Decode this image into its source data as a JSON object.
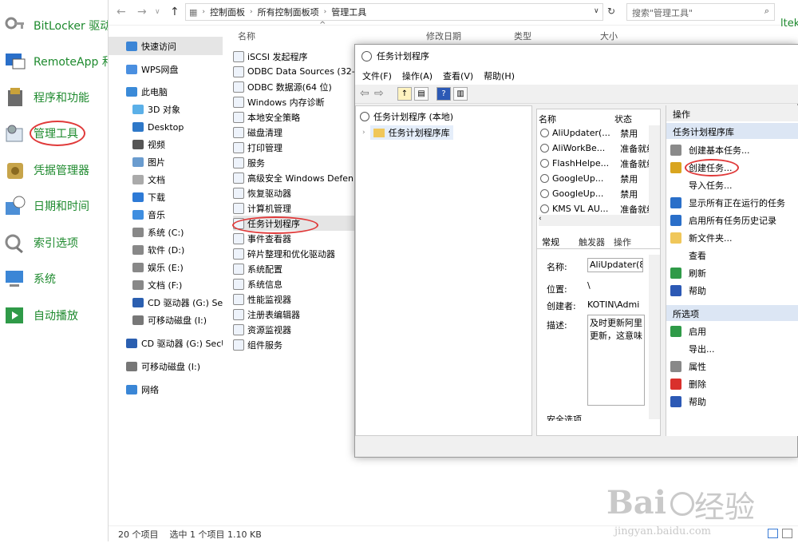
{
  "control_panel": {
    "items": [
      {
        "label": "BitLocker 驱动器加密",
        "icon": "bitlocker-key-icon"
      },
      {
        "label": "RemoteApp 和桌面连接",
        "icon": "remoteapp-icon"
      },
      {
        "label": "程序和功能",
        "icon": "programs-icon"
      },
      {
        "label": "管理工具",
        "icon": "admin-tools-icon"
      },
      {
        "label": "凭据管理器",
        "icon": "credential-vault-icon"
      },
      {
        "label": "日期和时间",
        "icon": "calendar-clock-icon"
      },
      {
        "label": "索引选项",
        "icon": "indexing-icon"
      },
      {
        "label": "系统",
        "icon": "system-computer-icon"
      },
      {
        "label": "自动播放",
        "icon": "autoplay-icon"
      }
    ]
  },
  "explorer": {
    "breadcrumb": [
      "控制面板",
      "所有控制面板项",
      "管理工具"
    ],
    "search_placeholder": "搜索\"管理工具\"",
    "right_edge_text": "ltek",
    "sidebar": [
      {
        "label": "快速访问",
        "icon": "star-icon"
      },
      {
        "label": "WPS网盘",
        "icon": "cloud-icon"
      },
      {
        "label": "此电脑",
        "icon": "computer-icon"
      },
      {
        "label": "3D 对象",
        "icon": "cube-icon"
      },
      {
        "label": "Desktop",
        "icon": "desktop-icon"
      },
      {
        "label": "视频",
        "icon": "video-icon"
      },
      {
        "label": "图片",
        "icon": "picture-icon"
      },
      {
        "label": "文档",
        "icon": "document-icon"
      },
      {
        "label": "下载",
        "icon": "download-icon"
      },
      {
        "label": "音乐",
        "icon": "music-icon"
      },
      {
        "label": "系统 (C:)",
        "icon": "drive-icon"
      },
      {
        "label": "软件 (D:)",
        "icon": "drive-icon"
      },
      {
        "label": "娱乐 (E:)",
        "icon": "drive-icon"
      },
      {
        "label": "文档 (F:)",
        "icon": "drive-icon"
      },
      {
        "label": "CD 驱动器 (G:) SecU",
        "icon": "cd-drive-icon"
      },
      {
        "label": "可移动磁盘 (I:)",
        "icon": "removable-drive-icon"
      },
      {
        "label": "CD 驱动器 (G:) SecU",
        "icon": "cd-drive-icon"
      },
      {
        "label": "可移动磁盘 (I:)",
        "icon": "removable-drive-icon"
      },
      {
        "label": "网络",
        "icon": "network-icon"
      }
    ],
    "columns": [
      "名称",
      "修改日期",
      "类型",
      "大小"
    ],
    "files": [
      "iSCSI 发起程序",
      "ODBC Data Sources (32-",
      "ODBC 数据源(64 位)",
      "Windows 内存诊断",
      "本地安全策略",
      "磁盘清理",
      "打印管理",
      "服务",
      "高级安全 Windows Defen",
      "恢复驱动器",
      "计算机管理",
      "任务计划程序",
      "事件查看器",
      "碎片整理和优化驱动器",
      "系统配置",
      "系统信息",
      "性能监视器",
      "注册表编辑器",
      "资源监视器",
      "组件服务"
    ],
    "status": {
      "count": "20 个项目",
      "selected": "选中 1 个项目  1.10 KB"
    }
  },
  "task_scheduler": {
    "title": "任务计划程序",
    "menu": [
      "文件(F)",
      "操作(A)",
      "查看(V)",
      "帮助(H)"
    ],
    "tree": {
      "root": "任务计划程序 (本地)",
      "child": "任务计划程序库"
    },
    "task_columns": [
      "名称",
      "状态"
    ],
    "tasks": [
      {
        "name": "AliUpdater(...",
        "status": "禁用"
      },
      {
        "name": "AliWorkBe...",
        "status": "准备就绪"
      },
      {
        "name": "FlashHelpe...",
        "status": "准备就绪"
      },
      {
        "name": "GoogleUp...",
        "status": "禁用"
      },
      {
        "name": "GoogleUp...",
        "status": "禁用"
      },
      {
        "name": "KMS VL AU...",
        "status": "准备就绪"
      }
    ],
    "tabs": [
      "常规",
      "触发器",
      "操作"
    ],
    "general": {
      "name_label": "名称:",
      "name_value": "AliUpdater(8",
      "location_label": "位置:",
      "location_value": "\\",
      "author_label": "创建者:",
      "author_value": "KOTIN\\Admi",
      "desc_label": "描述:",
      "desc_value_1": "及时更新阿里",
      "desc_value_2": "更新，这意味",
      "security_label": "安全选项"
    },
    "actions_header": "操作",
    "library_header": "任务计划程序库",
    "library_actions": [
      {
        "label": "创建基本任务...",
        "icon": "clock-wizard-icon"
      },
      {
        "label": "创建任务...",
        "icon": "clock-new-icon"
      },
      {
        "label": "导入任务...",
        "icon": ""
      },
      {
        "label": "显示所有正在运行的任务",
        "icon": "running-tasks-icon"
      },
      {
        "label": "启用所有任务历史记录",
        "icon": "history-icon"
      },
      {
        "label": "新文件夹...",
        "icon": "folder-icon"
      },
      {
        "label": "查看",
        "icon": ""
      },
      {
        "label": "刷新",
        "icon": "refresh-icon"
      },
      {
        "label": "帮助",
        "icon": "help-icon"
      }
    ],
    "selected_header": "所选项",
    "selected_actions": [
      {
        "label": "启用",
        "icon": "enable-arrow-icon"
      },
      {
        "label": "导出...",
        "icon": ""
      },
      {
        "label": "属性",
        "icon": "properties-icon"
      },
      {
        "label": "删除",
        "icon": "delete-icon"
      },
      {
        "label": "帮助",
        "icon": "help-icon"
      }
    ]
  },
  "watermark": {
    "brand": "Bai",
    "brand2": "经验",
    "url": "jingyan.baidu.com"
  },
  "colors": {
    "accent_green": "#1e8a2e",
    "highlight_red": "#e03a3a",
    "selection": "#e5e5e5",
    "pane_header": "#dce6f4"
  }
}
